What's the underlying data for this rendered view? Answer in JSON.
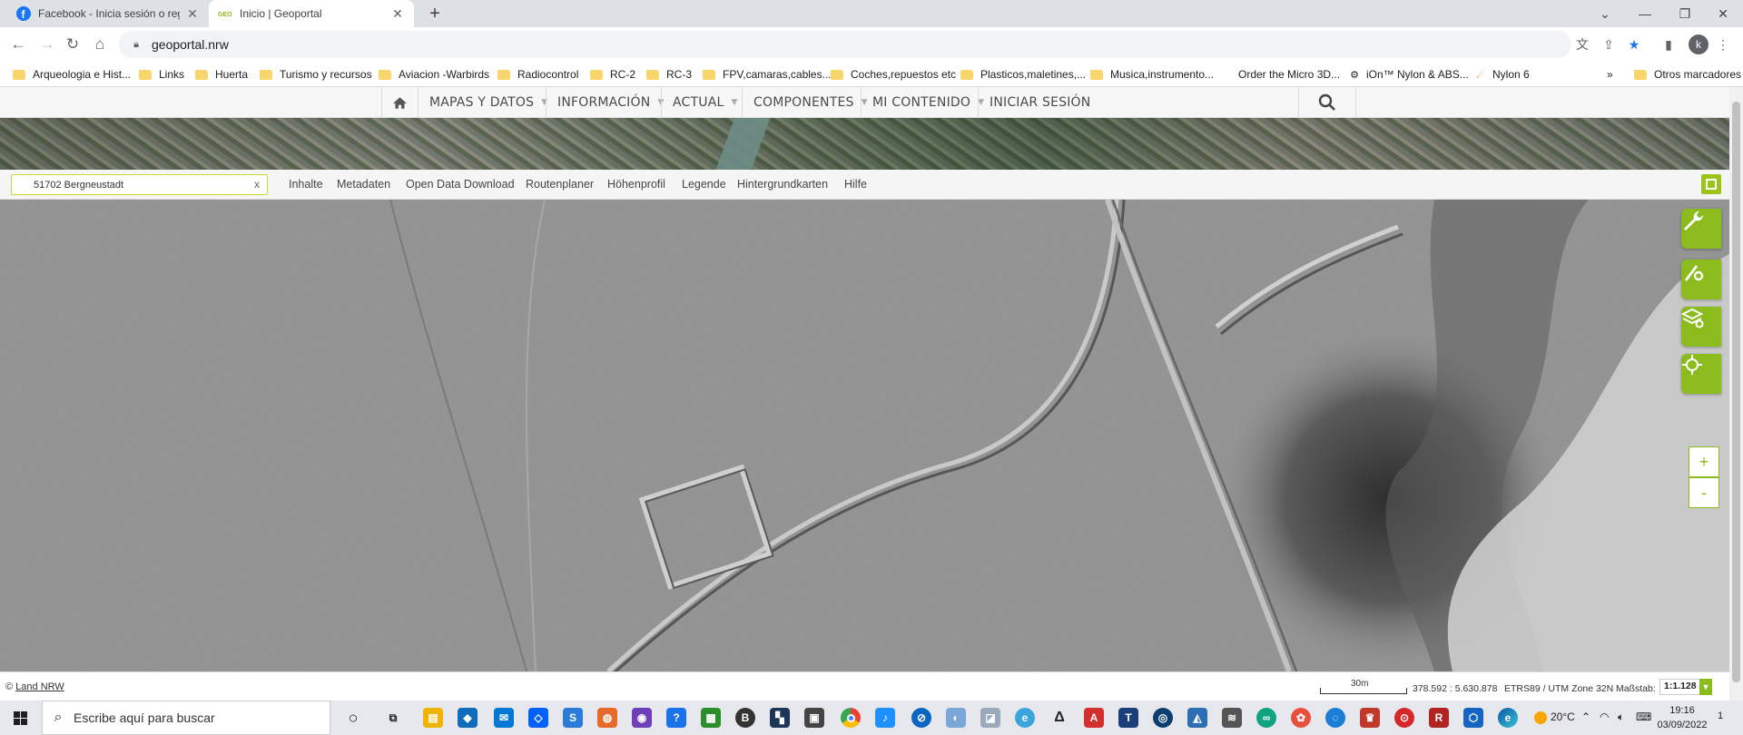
{
  "browser": {
    "tabs": [
      {
        "title": "Facebook - Inicia sesión o regístr",
        "favicon": "facebook-icon",
        "color": "#1877f2"
      },
      {
        "title": "Inicio | Geoportal",
        "favicon": "geo-icon",
        "color": "#8cbb1e"
      }
    ],
    "url": "geoportal.nrw",
    "profile_initial": "k"
  },
  "bookmarks": [
    {
      "label": "Arqueologia e Hist...",
      "icon": "folder-icon"
    },
    {
      "label": "Links",
      "icon": "folder-icon"
    },
    {
      "label": "Huerta",
      "icon": "folder-icon"
    },
    {
      "label": "Turismo y recursos",
      "icon": "folder-icon"
    },
    {
      "label": "Aviacion -Warbirds",
      "icon": "folder-icon"
    },
    {
      "label": "Radiocontrol",
      "icon": "folder-icon"
    },
    {
      "label": "RC-2",
      "icon": "folder-icon"
    },
    {
      "label": "RC-3",
      "icon": "folder-icon"
    },
    {
      "label": "FPV,camaras,cables...",
      "icon": "folder-icon"
    },
    {
      "label": "Coches,repuestos etc",
      "icon": "folder-icon"
    },
    {
      "label": "Plasticos,maletines,...",
      "icon": "folder-icon"
    },
    {
      "label": "Musica,instrumento...",
      "icon": "folder-icon"
    },
    {
      "label": "Order the Micro 3D...",
      "icon": "page-icon"
    },
    {
      "label": "iOn™ Nylon & ABS...",
      "icon": "gear-icon"
    },
    {
      "label": "Nylon 6",
      "icon": "flame-icon"
    },
    {
      "label": "»",
      "icon": "overflow-icon"
    },
    {
      "label": "Otros marcadores",
      "icon": "folder-icon"
    }
  ],
  "geoportal": {
    "menu": [
      {
        "label": "MAPAS Y DATOS",
        "caret": true
      },
      {
        "label": "INFORMACIÓN",
        "caret": true
      },
      {
        "label": "ACTUAL",
        "caret": true
      },
      {
        "label": "COMPONENTES",
        "caret": true
      },
      {
        "label": "MI CONTENIDO",
        "caret": true
      },
      {
        "label": "INICIAR SESIÓN",
        "caret": false
      }
    ],
    "search_value": "51702 Bergneustadt",
    "search_clear": "x",
    "toolbar_links": [
      "Inhalte",
      "Metadaten",
      "Open Data Download",
      "Routenplaner",
      "Höhenprofil",
      "Legende",
      "Hintergrundkarten",
      "Hilfe"
    ],
    "zoom_in": "+",
    "zoom_out": "-",
    "accent": "#8cbb1e"
  },
  "status": {
    "copyright_symbol": "©",
    "copyright_link": "Land NRW",
    "scalebar_label": "30m",
    "coordinates": "378.592 : 5.630.878",
    "crs": "ETRS89 / UTM Zone 32N",
    "scale_label": "Maßstab:",
    "scale_value": "1:1.128"
  },
  "taskbar": {
    "search_placeholder": "Escribe aquí para buscar",
    "temperature": "20°C",
    "time": "19:16",
    "date": "03/09/2022",
    "notification_count": "1"
  }
}
